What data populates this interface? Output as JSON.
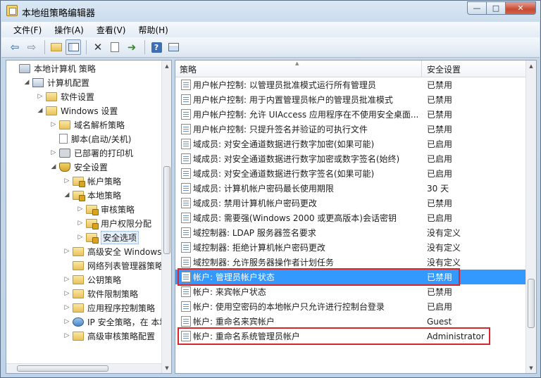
{
  "window": {
    "title": "本地组策略编辑器",
    "caption_buttons": [
      "—",
      "□",
      "✕"
    ]
  },
  "menu": [
    "文件(F)",
    "操作(A)",
    "查看(V)",
    "帮助(H)"
  ],
  "toolbar": [
    "back-arrow-icon",
    "forward-arrow-icon",
    "up-folder-icon",
    "show-hide-tree-icon",
    "delete-icon",
    "properties-icon",
    "export-list-icon",
    "help-icon",
    "view-icon"
  ],
  "tree": {
    "items": [
      {
        "label": "本地计算机 策略",
        "indent": 0,
        "expanded": "none",
        "icon": "policy-icon"
      },
      {
        "label": "计算机配置",
        "indent": 1,
        "expanded": "open",
        "icon": "computer-icon"
      },
      {
        "label": "软件设置",
        "indent": 2,
        "expanded": "closed",
        "icon": "folder-icon"
      },
      {
        "label": "Windows 设置",
        "indent": 2,
        "expanded": "open",
        "icon": "folder-icon"
      },
      {
        "label": "域名解析策略",
        "indent": 3,
        "expanded": "closed",
        "icon": "folder-icon"
      },
      {
        "label": "脚本(启动/关机)",
        "indent": 3,
        "expanded": "none",
        "icon": "doc-icon"
      },
      {
        "label": "已部署的打印机",
        "indent": 3,
        "expanded": "closed",
        "icon": "printer-icon"
      },
      {
        "label": "安全设置",
        "indent": 3,
        "expanded": "open",
        "icon": "shield-icon"
      },
      {
        "label": "帐户策略",
        "indent": 4,
        "expanded": "closed",
        "icon": "lockfolder-icon"
      },
      {
        "label": "本地策略",
        "indent": 4,
        "expanded": "open",
        "icon": "lockfolder-icon"
      },
      {
        "label": "审核策略",
        "indent": 5,
        "expanded": "closed",
        "icon": "lockfolder-icon"
      },
      {
        "label": "用户权限分配",
        "indent": 5,
        "expanded": "closed",
        "icon": "lockfolder-icon"
      },
      {
        "label": "安全选项",
        "indent": 5,
        "expanded": "closed",
        "icon": "lockfolder-icon",
        "selected": true
      },
      {
        "label": "高级安全 Windows 防火",
        "indent": 4,
        "expanded": "closed",
        "icon": "folder-icon"
      },
      {
        "label": "网络列表管理器策略",
        "indent": 4,
        "expanded": "none",
        "icon": "folder-icon"
      },
      {
        "label": "公钥策略",
        "indent": 4,
        "expanded": "closed",
        "icon": "folder-icon"
      },
      {
        "label": "软件限制策略",
        "indent": 4,
        "expanded": "closed",
        "icon": "folder-icon"
      },
      {
        "label": "应用程序控制策略",
        "indent": 4,
        "expanded": "closed",
        "icon": "folder-icon"
      },
      {
        "label": "IP 安全策略，在 本地计算",
        "indent": 4,
        "expanded": "closed",
        "icon": "ipsec-icon"
      },
      {
        "label": "高级审核策略配置",
        "indent": 4,
        "expanded": "closed",
        "icon": "folder-icon"
      }
    ]
  },
  "list": {
    "headers": {
      "policy": "策略",
      "setting": "安全设置"
    },
    "rows": [
      {
        "name": "用户帐户控制: 以管理员批准模式运行所有管理员",
        "value": "已禁用"
      },
      {
        "name": "用户帐户控制: 用于内置管理员帐户的管理员批准模式",
        "value": "已禁用"
      },
      {
        "name": "用户帐户控制: 允许 UIAccess 应用程序在不使用安全桌面...",
        "value": "已禁用"
      },
      {
        "name": "用户帐户控制: 只提升签名并验证的可执行文件",
        "value": "已禁用"
      },
      {
        "name": "域成员: 对安全通道数据进行数字加密(如果可能)",
        "value": "已启用"
      },
      {
        "name": "域成员: 对安全通道数据进行数字加密或数字签名(始终)",
        "value": "已启用"
      },
      {
        "name": "域成员: 对安全通道数据进行数字签名(如果可能)",
        "value": "已启用"
      },
      {
        "name": "域成员: 计算机帐户密码最长使用期限",
        "value": "30 天"
      },
      {
        "name": "域成员: 禁用计算机帐户密码更改",
        "value": "已禁用"
      },
      {
        "name": "域成员: 需要强(Windows 2000 或更高版本)会话密钥",
        "value": "已启用"
      },
      {
        "name": "域控制器: LDAP 服务器签名要求",
        "value": "没有定义"
      },
      {
        "name": "域控制器: 拒绝计算机帐户密码更改",
        "value": "没有定义"
      },
      {
        "name": "域控制器: 允许服务器操作者计划任务",
        "value": "没有定义"
      },
      {
        "name": "帐户: 管理员帐户状态",
        "value": "已禁用",
        "selected": true
      },
      {
        "name": "帐户: 来宾帐户状态",
        "value": "已禁用"
      },
      {
        "name": "帐户: 使用空密码的本地帐户只允许进行控制台登录",
        "value": "已启用"
      },
      {
        "name": "帐户: 重命名来宾帐户",
        "value": "Guest"
      },
      {
        "name": "帐户: 重命名系统管理员帐户",
        "value": "Administrator"
      }
    ]
  },
  "colors": {
    "selection": "#3399ff",
    "highlight_box": "#d9262c"
  }
}
